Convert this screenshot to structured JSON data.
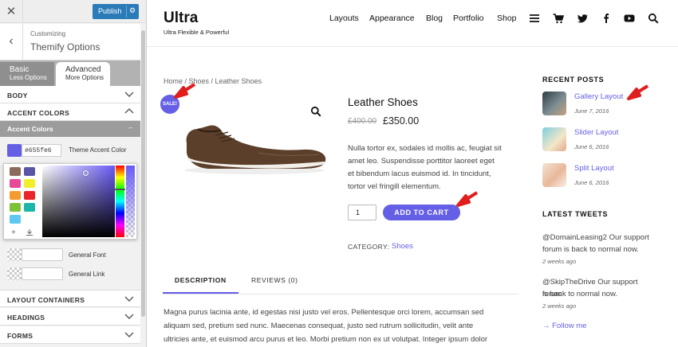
{
  "customizer": {
    "close_icon": "close-icon",
    "publish_label": "Publish",
    "customizing_label": "Customizing",
    "section_title": "Themify Options",
    "tabs": [
      {
        "title": "Basic",
        "subtitle": "Less Options"
      },
      {
        "title": "Advanced",
        "subtitle": "More Options"
      }
    ],
    "sections_top": [
      "BODY",
      "ACCENT COLORS"
    ],
    "accent_sub": "Accent Colors",
    "accent_sub_toggle": "–",
    "theme_accent": {
      "hex": "#655fe6",
      "label": "Theme Accent Color"
    },
    "palette_colors": [
      "#8b6a5c",
      "#5a54a6",
      "#e84a9a",
      "#f0ef2a",
      "#f49a2e",
      "#e8252a",
      "#7ec23a",
      "#1cb5a8",
      "#5ec8f0"
    ],
    "font_rows": [
      "General Font",
      "General Link"
    ],
    "sections_bottom": [
      "LAYOUT CONTAINERS",
      "HEADINGS",
      "FORMS"
    ]
  },
  "site": {
    "logo": "Ultra",
    "tagline": "Ultra Flexible & Powerful",
    "nav": [
      "Layouts",
      "Appearance",
      "Blog",
      "Portfolio",
      "Shop"
    ],
    "nav_icons": [
      "menu-icon",
      "cart-icon",
      "twitter-icon",
      "facebook-icon",
      "youtube-icon",
      "search-icon"
    ]
  },
  "product": {
    "breadcrumb": "Home / Shoes / Leather Shoes",
    "sale_badge": "SALE!",
    "title": "Leather Shoes",
    "old_price": "£400.00",
    "price": "£350.00",
    "description_lines": [
      "Nulla tortor ex, sodales id mollis ac, feugiat sit",
      "amet leo. Suspendisse porttitor laoreet eget",
      "et bibendum lacus euismod id. In tincidunt,",
      "tortor vel fringill elementum."
    ],
    "quantity": "1",
    "add_to_cart": "ADD TO CART",
    "category_label": "CATEGORY:",
    "category_value": "Shoes",
    "tabs": [
      "DESCRIPTION",
      "REVIEWS (0)"
    ],
    "body_lines": [
      "Magna purus lacinia ante, id egestas nisi justo vel eros. Pellentesque orci lorem, accumsan sed",
      "aliquam sed, pretium sed nunc. Maecenas consequat, justo sed rutrum sollicitudin, velit ante",
      "ultricies ante, et euismod arcu purus et leo. Morbi pretium non ex ut volutpat. Integer ipsum dolor"
    ]
  },
  "sidebar": {
    "recent_heading": "RECENT POSTS",
    "recent_posts": [
      {
        "title": "Gallery Layout",
        "date": "June 7, 2016"
      },
      {
        "title": "Slider Layout",
        "date": "June 6, 2016"
      },
      {
        "title": "Split Layout",
        "date": "June 6, 2016"
      }
    ],
    "tweets_heading": "LATEST TWEETS",
    "tweets": [
      {
        "lines": [
          "@DomainLeasing2 Our support",
          "forum is back to normal now."
        ],
        "time": "2 weeks ago"
      },
      {
        "lines": [
          "@SkipTheDrive Our support forum",
          "is back to normal now."
        ],
        "time": "2 weeks ago"
      }
    ],
    "follow": "→ Follow me"
  }
}
